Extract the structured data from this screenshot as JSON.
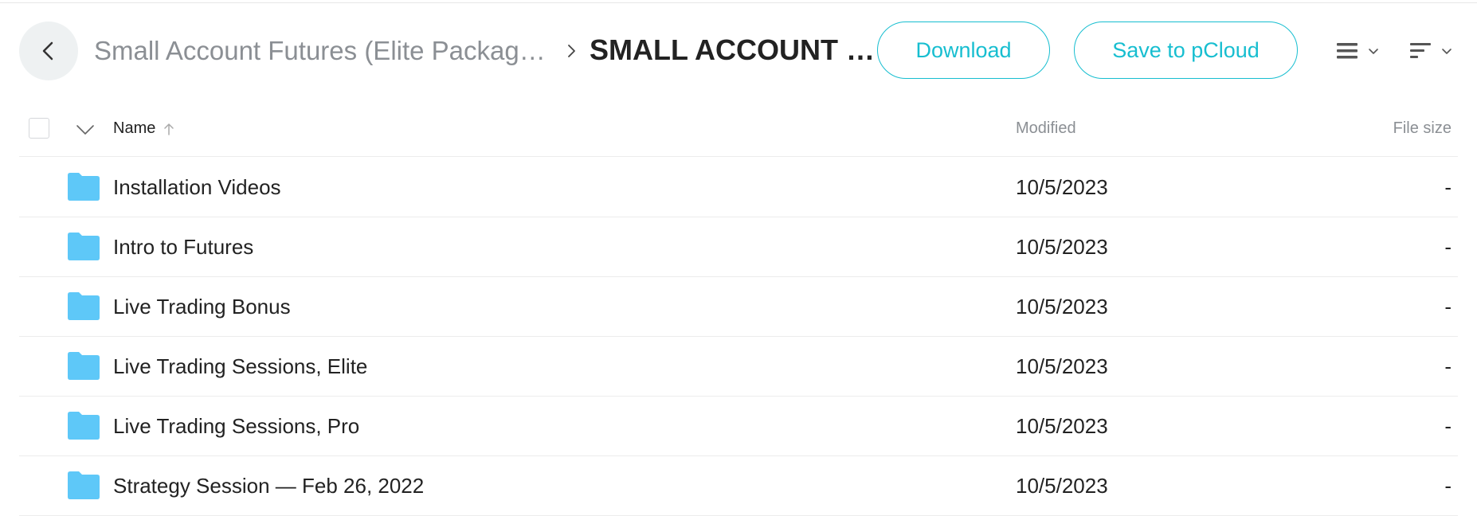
{
  "breadcrumb": {
    "parent": "Small Account Futures (Elite Packag…",
    "current": "SMALL ACCOUNT …"
  },
  "toolbar": {
    "download_label": "Download",
    "save_label": "Save to pCloud"
  },
  "table": {
    "columns": {
      "name": "Name",
      "modified": "Modified",
      "size": "File size"
    },
    "rows": [
      {
        "name": "Installation Videos",
        "modified": "10/5/2023",
        "size": "-"
      },
      {
        "name": "Intro to Futures",
        "modified": "10/5/2023",
        "size": "-"
      },
      {
        "name": "Live Trading Bonus",
        "modified": "10/5/2023",
        "size": "-"
      },
      {
        "name": "Live Trading Sessions, Elite",
        "modified": "10/5/2023",
        "size": "-"
      },
      {
        "name": "Live Trading Sessions, Pro",
        "modified": "10/5/2023",
        "size": "-"
      },
      {
        "name": "Strategy Session — Feb 26, 2022",
        "modified": "10/5/2023",
        "size": "-"
      }
    ]
  },
  "colors": {
    "accent": "#17bed0",
    "folder": "#5ec8f8",
    "muted_text": "#8b8f94"
  },
  "icons": {
    "back": "arrow-left-icon",
    "breadcrumb_separator": "chevron-right-icon",
    "view_mode": "list-view-icon",
    "sort": "sort-icon",
    "row_type": "folder-icon"
  }
}
